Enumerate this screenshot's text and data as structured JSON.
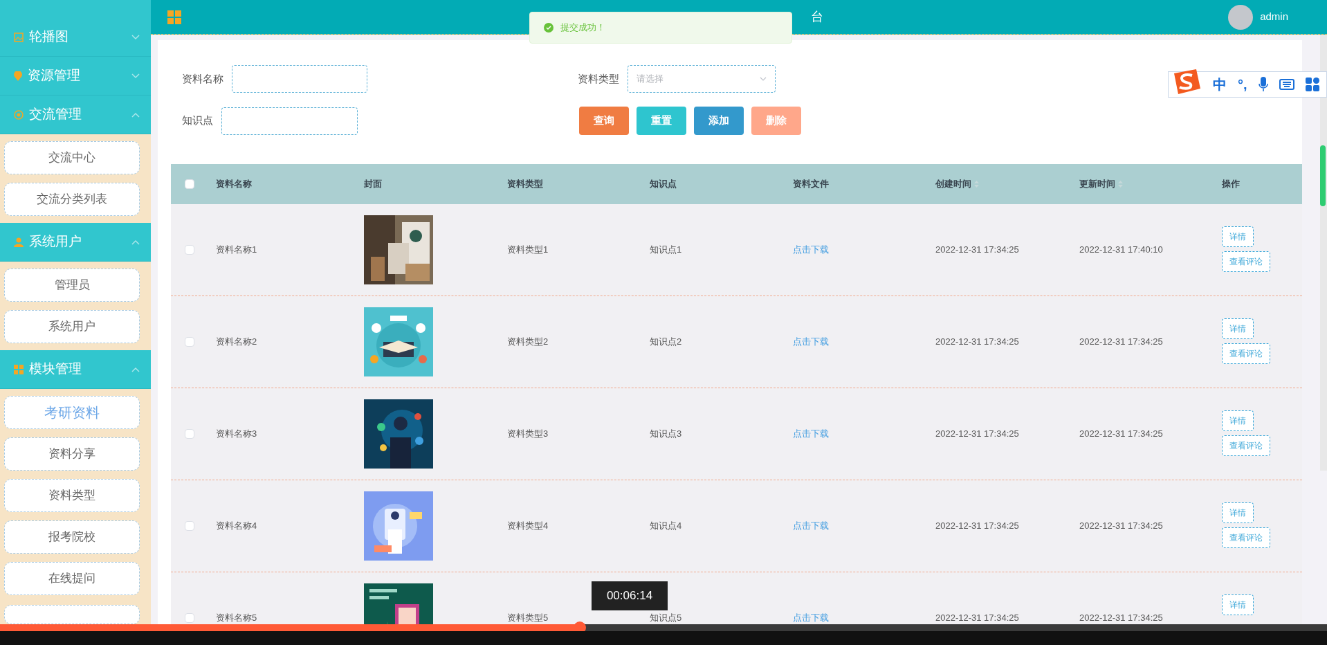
{
  "header": {
    "title": "台",
    "user": "admin"
  },
  "toast": {
    "message": "提交成功！"
  },
  "sidebar": [
    {
      "label": "轮播图",
      "expanded": false
    },
    {
      "label": "资源管理",
      "expanded": false
    },
    {
      "label": "交流管理",
      "expanded": true,
      "children": [
        {
          "label": "交流中心",
          "selected": false
        },
        {
          "label": "交流分类列表",
          "selected": false
        }
      ]
    },
    {
      "label": "系统用户",
      "expanded": true,
      "children": [
        {
          "label": "管理员",
          "selected": false
        },
        {
          "label": "系统用户",
          "selected": false
        }
      ]
    },
    {
      "label": "模块管理",
      "expanded": true,
      "children": [
        {
          "label": "考研资料",
          "selected": true
        },
        {
          "label": "资料分享",
          "selected": false
        },
        {
          "label": "资料类型",
          "selected": false
        },
        {
          "label": "报考院校",
          "selected": false
        },
        {
          "label": "在线提问",
          "selected": false
        }
      ]
    }
  ],
  "search": {
    "name_label": "资料名称",
    "type_label": "资料类型",
    "type_placeholder": "请选择",
    "point_label": "知识点"
  },
  "buttons": [
    {
      "label": "查询",
      "kind": "query"
    },
    {
      "label": "重置",
      "kind": "reset"
    },
    {
      "label": "添加",
      "kind": "add"
    },
    {
      "label": "删除",
      "kind": "delete"
    }
  ],
  "table": {
    "header_checked": false,
    "columns": [
      "资料名称",
      "封面",
      "资料类型",
      "知识点",
      "资料文件",
      "创建时间",
      "更新时间",
      "操作"
    ],
    "rows": [
      {
        "checked": false,
        "name": "资料名称1",
        "cover": {
          "kind": "picture"
        },
        "type": "资料类型1",
        "point": "知识点1",
        "file": "点击下载",
        "created": "2022-12-31 17:34:25",
        "updated": "2022-12-31 17:40:10",
        "actions": [
          "详情",
          "查看评论"
        ]
      },
      {
        "checked": false,
        "name": "资料名称2",
        "cover": {
          "kind": "picture"
        },
        "type": "资料类型2",
        "point": "知识点2",
        "file": "点击下载",
        "created": "2022-12-31 17:34:25",
        "updated": "2022-12-31 17:34:25",
        "actions": [
          "详情",
          "查看评论"
        ]
      },
      {
        "checked": false,
        "name": "资料名称3",
        "cover": {
          "kind": "picture"
        },
        "type": "资料类型3",
        "point": "知识点3",
        "file": "点击下载",
        "created": "2022-12-31 17:34:25",
        "updated": "2022-12-31 17:34:25",
        "actions": [
          "详情",
          "查看评论"
        ]
      },
      {
        "checked": false,
        "name": "资料名称4",
        "cover": {
          "kind": "picture"
        },
        "type": "资料类型4",
        "point": "知识点4",
        "file": "点击下载",
        "created": "2022-12-31 17:34:25",
        "updated": "2022-12-31 17:34:25",
        "actions": [
          "详情",
          "查看评论"
        ]
      },
      {
        "checked": false,
        "name": "资料名称5",
        "cover": {
          "kind": "picture"
        },
        "type": "资料类型5",
        "point": "知识点5",
        "file": "点击下载",
        "created": "2022-12-31 17:34:25",
        "updated": "2022-12-31 17:34:25",
        "actions": [
          "详情"
        ]
      }
    ]
  },
  "ime_toolbar": {
    "items": [
      "中",
      "°,"
    ]
  },
  "video": {
    "time": "00:06:14",
    "level": 0.437
  }
}
